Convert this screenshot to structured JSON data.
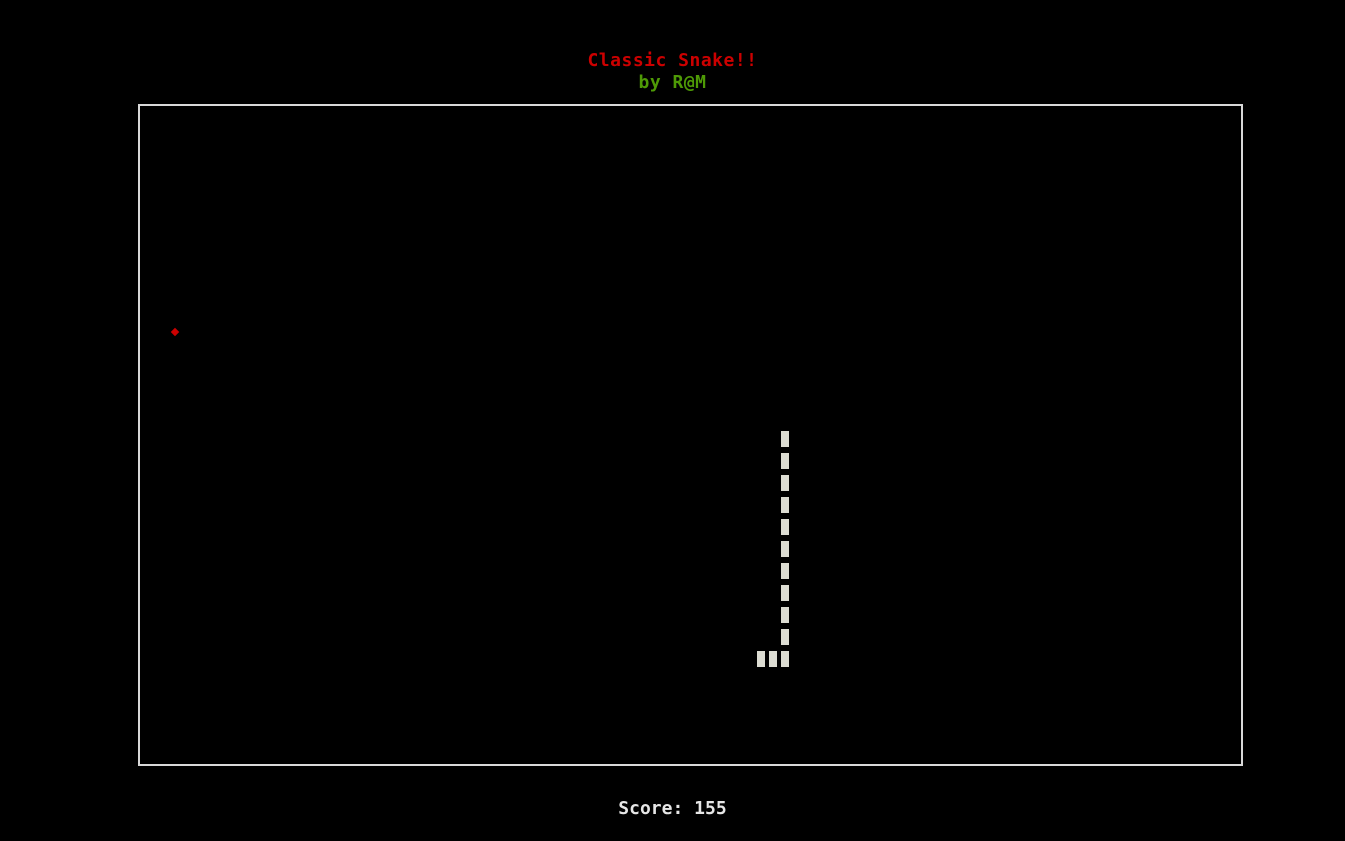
{
  "header": {
    "title": "Classic Snake!!",
    "author": "by R@M"
  },
  "colors": {
    "title": "#cc0000",
    "author": "#4e9a06",
    "food": "#cc0000",
    "snake": "#dcdcd2",
    "border": "#d8d8d8",
    "background": "#000000"
  },
  "score": {
    "label": "Score:",
    "value": "155"
  },
  "game": {
    "grid_cols": 92,
    "grid_rows": 30,
    "food_cell": [
      1,
      9
    ],
    "snake_cells": [
      [
        53,
        14
      ],
      [
        53,
        15
      ],
      [
        53,
        16
      ],
      [
        53,
        17
      ],
      [
        53,
        18
      ],
      [
        53,
        19
      ],
      [
        53,
        20
      ],
      [
        53,
        21
      ],
      [
        53,
        22
      ],
      [
        53,
        23
      ],
      [
        53,
        24
      ],
      [
        52,
        24
      ],
      [
        51,
        24
      ]
    ]
  }
}
